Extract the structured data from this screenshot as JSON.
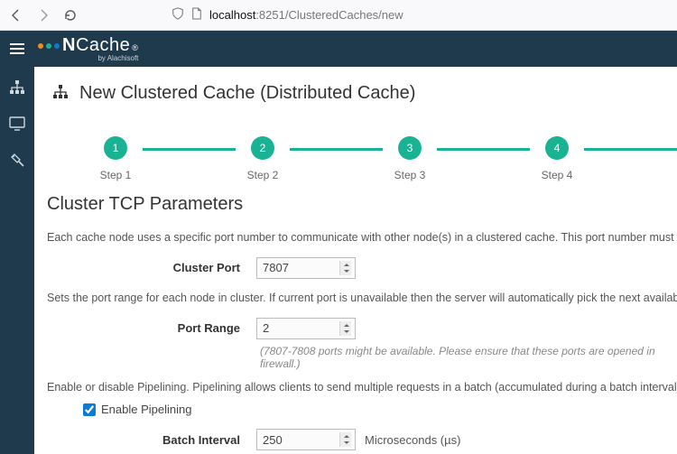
{
  "browser": {
    "url_host": "localhost",
    "url_port_path": ":8251/ClusteredCaches/new"
  },
  "brand": {
    "name_prefix": "N",
    "name_rest": "Cache",
    "byline": "by Alachisoft",
    "logo_colors": [
      "#f28c1f",
      "#19b394",
      "#0a7cd5"
    ]
  },
  "page": {
    "title": "New Clustered Cache (Distributed Cache)"
  },
  "stepper": {
    "steps": [
      {
        "num": "1",
        "label": "Step 1"
      },
      {
        "num": "2",
        "label": "Step 2"
      },
      {
        "num": "3",
        "label": "Step 3"
      },
      {
        "num": "4",
        "label": "Step 4"
      }
    ]
  },
  "section": {
    "title": "Cluster TCP Parameters",
    "intro_port": "Each cache node uses a specific port number to communicate with other node(s) in a clustered cache. This port number must be unique on every c",
    "cluster_port_label": "Cluster Port",
    "cluster_port_value": "7807",
    "intro_range": "Sets the port range for each node in cluster. If current port is unavailable then the server will automatically pick the next available port in the pool.",
    "port_range_label": "Port Range",
    "port_range_value": "2",
    "port_range_hint": "(7807-7808 ports might be available. Please ensure that these ports are opened in firewall.)",
    "intro_pipelining": "Enable or disable Pipelining. Pipelining allows clients to send multiple requests in a batch (accumulated during a batch interval) using a single TCP",
    "enable_pipelining_label": "Enable Pipelining",
    "batch_interval_label": "Batch Interval",
    "batch_interval_value": "250",
    "batch_interval_unit": "Microseconds (µs)"
  }
}
